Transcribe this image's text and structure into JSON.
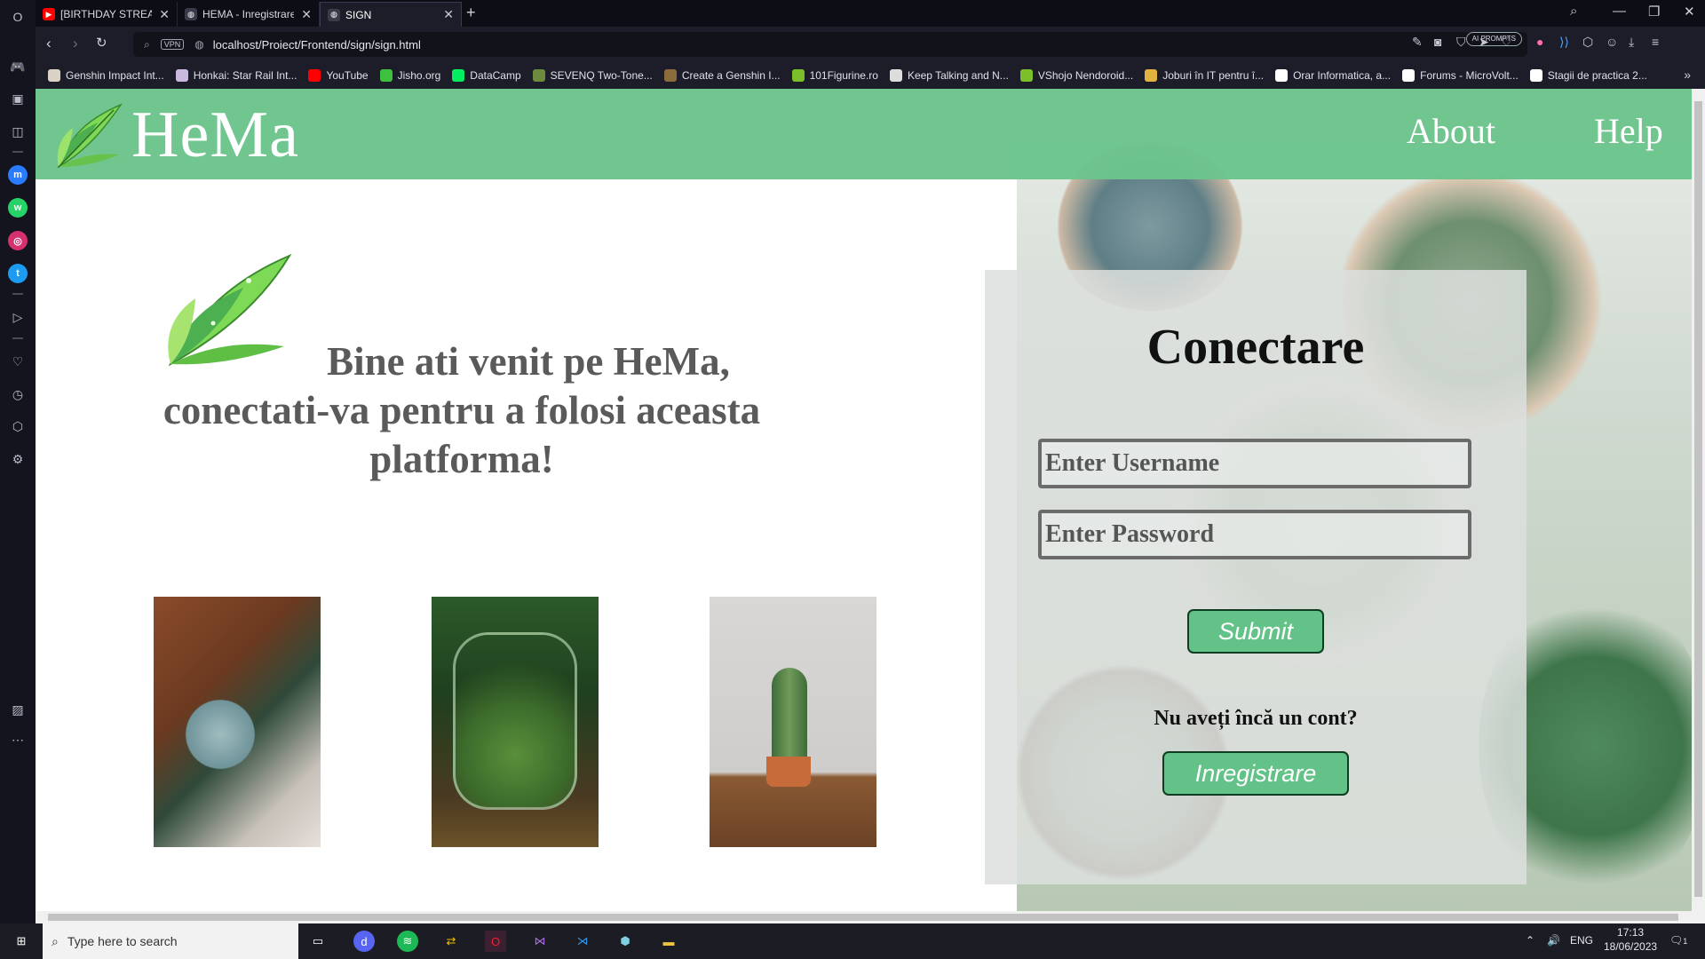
{
  "browser": {
    "tabs": [
      {
        "title": "[BIRTHDAY STREAM]Let's",
        "favicon": "youtube-icon",
        "active": false
      },
      {
        "title": "HEMA - Inregistrare",
        "favicon": "globe-icon",
        "active": false
      },
      {
        "title": "SIGN",
        "favicon": "globe-icon",
        "active": true
      }
    ],
    "url": "localhost/Proiect/Frontend/sign/sign.html",
    "vpn_label": "VPN",
    "ai_prompts_label": "AI PROMPTS",
    "bookmarks": [
      {
        "label": "Genshin Impact Int...",
        "color": "#d9d2c5"
      },
      {
        "label": "Honkai: Star Rail Int...",
        "color": "#c9b8e0"
      },
      {
        "label": "YouTube",
        "color": "#ff0000"
      },
      {
        "label": "Jisho.org",
        "color": "#3ec13e"
      },
      {
        "label": "DataCamp",
        "color": "#03ef62"
      },
      {
        "label": "SEVENQ Two-Tone...",
        "color": "#6e8b3d"
      },
      {
        "label": "Create a Genshin I...",
        "color": "#8a6d3b"
      },
      {
        "label": "101Figurine.ro",
        "color": "#7cbf2a"
      },
      {
        "label": "Keep Talking and N...",
        "color": "#dddddd"
      },
      {
        "label": "VShojo Nendoroid...",
        "color": "#7cbf2a"
      },
      {
        "label": "Joburi în IT pentru î...",
        "color": "#e3b341"
      },
      {
        "label": "Orar Informatica, a...",
        "color": "#ffffff"
      },
      {
        "label": "Forums - MicroVolt...",
        "color": "#ffffff"
      },
      {
        "label": "Stagii de practica 2...",
        "color": "#ffffff"
      }
    ]
  },
  "site": {
    "logo_text": "HeMa",
    "nav": {
      "about": "About",
      "help": "Help"
    },
    "welcome_line1": "Bine ati venit pe HeMa,",
    "welcome_line2": "conectati-va pentru a folosi aceasta platforma!",
    "photos": [
      "succulent-pots-photo",
      "terrarium-jar-photo",
      "snake-plant-photo"
    ]
  },
  "login": {
    "title": "Conectare",
    "username_placeholder": "Enter Username",
    "password_placeholder": "Enter Password",
    "submit_label": "Submit",
    "no_account_text": "Nu aveți încă un cont?",
    "register_label": "Inregistrare"
  },
  "taskbar": {
    "search_placeholder": "Type here to search",
    "language": "ENG",
    "time": "17:13",
    "date": "18/06/2023",
    "notification_count": "1"
  },
  "colors": {
    "header_green": "#6cc48c",
    "button_green": "#63c287",
    "browser_dark": "#1d1d29"
  }
}
